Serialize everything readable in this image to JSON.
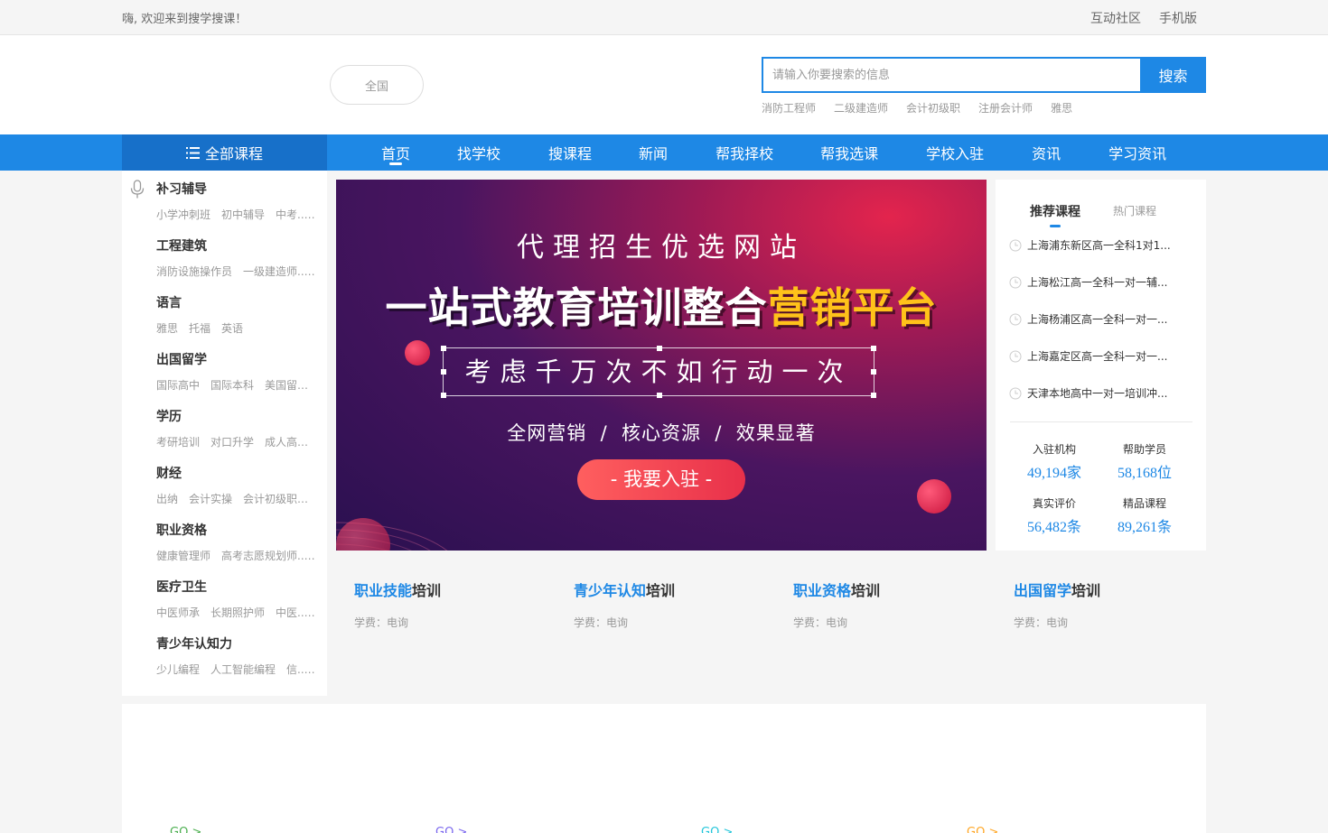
{
  "topbar": {
    "welcome": "嗨, 欢迎来到搜学搜课！",
    "community": "互动社区",
    "mobile": "手机版"
  },
  "header": {
    "region": "全国",
    "search_placeholder": "请输入你要搜索的信息",
    "search_button": "搜索",
    "hot_words": [
      "消防工程师",
      "二级建造师",
      "会计初级职",
      "注册会计师",
      "雅思"
    ]
  },
  "nav": {
    "all_courses": "全部课程",
    "items": [
      "首页",
      "找学校",
      "搜课程",
      "新闻",
      "帮我择校",
      "帮我选课",
      "学校入驻",
      "资讯",
      "学习资讯"
    ]
  },
  "categories": [
    {
      "title": "补习辅导",
      "subs": [
        "小学冲刺班",
        "初中辅导",
        "中考..."
      ]
    },
    {
      "title": "工程建筑",
      "subs": [
        "消防设施操作员",
        "一级建造师..."
      ]
    },
    {
      "title": "语言",
      "subs": [
        "雅思",
        "托福",
        "英语"
      ]
    },
    {
      "title": "出国留学",
      "subs": [
        "国际高中",
        "国际本科",
        "美国留学"
      ]
    },
    {
      "title": "学历",
      "subs": [
        "考研培训",
        "对口升学",
        "成人高考"
      ]
    },
    {
      "title": "财经",
      "subs": [
        "出纳",
        "会计实操",
        "会计初级职称"
      ]
    },
    {
      "title": "职业资格",
      "subs": [
        "健康管理师",
        "高考志愿规划师..."
      ]
    },
    {
      "title": "医疗卫生",
      "subs": [
        "中医师承",
        "长期照护师",
        "中医..."
      ]
    },
    {
      "title": "青少年认知力",
      "subs": [
        "少儿编程",
        "人工智能编程",
        "信..."
      ]
    }
  ],
  "banner": {
    "subtitle": "代理招生优选网站",
    "main_white": "一站式教育培训整合",
    "main_highlight": "营销平台",
    "box_text": "考虑千万次不如行动一次",
    "tags": "全网营销  /  核心资源  /  效果显著",
    "cta": "- 我要入驻 -"
  },
  "recommend": {
    "tab_active": "推荐课程",
    "tab_inactive": "热门课程",
    "items": [
      "上海浦东新区高一全科1对1...",
      "上海松江高一全科一对一辅...",
      "上海杨浦区高一全科一对一...",
      "上海嘉定区高一全科一对一...",
      "天津本地高中一对一培训冲..."
    ],
    "stats": [
      {
        "label": "入驻机构",
        "value": "49,194家"
      },
      {
        "label": "帮助学员",
        "value": "58,168位"
      },
      {
        "label": "真实评价",
        "value": "56,482条"
      },
      {
        "label": "精品课程",
        "value": "89,261条"
      }
    ]
  },
  "training": [
    {
      "blue": "职业技能",
      "rest": "培训",
      "fee": "学费：电询"
    },
    {
      "blue": "青少年认知",
      "rest": "培训",
      "fee": "学费：电询"
    },
    {
      "blue": "职业资格",
      "rest": "培训",
      "fee": "学费：电询"
    },
    {
      "blue": "出国留学",
      "rest": "培训",
      "fee": "学费：电询"
    }
  ],
  "bottom": {
    "go_links": [
      "GO >",
      "GO >",
      "GO >",
      "GO >"
    ],
    "go_colors": [
      "#4caf50",
      "#7b68ee",
      "#26c6da",
      "#ffa726"
    ]
  },
  "colors": {
    "primary": "#1e88e5",
    "highlight": "#ffc21a"
  }
}
